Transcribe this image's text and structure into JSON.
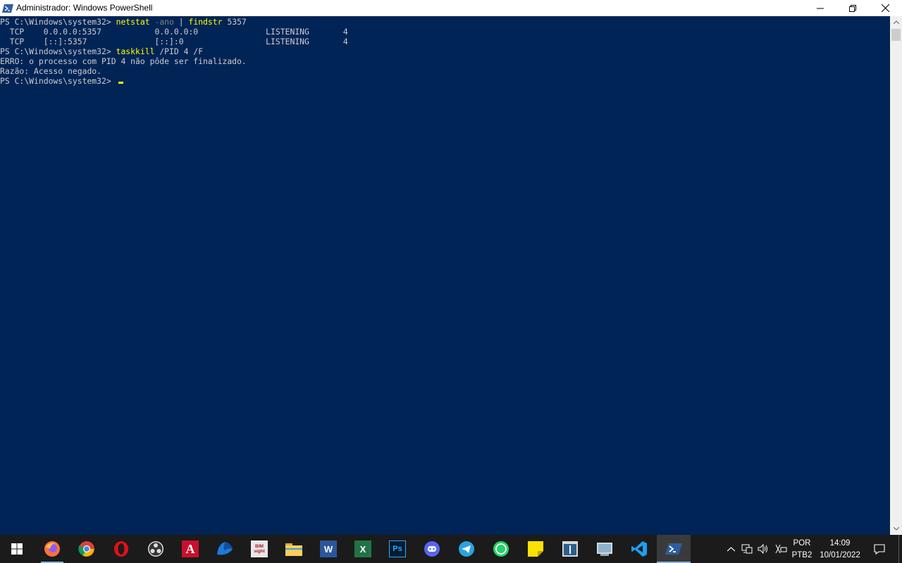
{
  "window": {
    "title": "Administrador: Windows PowerShell"
  },
  "console": {
    "lines": [
      {
        "segments": [
          {
            "text": "PS C:\\Windows\\system32> ",
            "style": "white"
          },
          {
            "text": "netstat",
            "style": "cmd"
          },
          {
            "text": " -ano",
            "style": "param"
          },
          {
            "text": " | ",
            "style": "white"
          },
          {
            "text": "findstr",
            "style": "cmd"
          },
          {
            "text": " 5357",
            "style": "white"
          }
        ]
      },
      {
        "segments": [
          {
            "text": "  TCP    0.0.0.0:5357           0.0.0.0:0              LISTENING       4",
            "style": "white"
          }
        ]
      },
      {
        "segments": [
          {
            "text": "  TCP    [::]:5357              [::]:0                 LISTENING       4",
            "style": "white"
          }
        ]
      },
      {
        "segments": [
          {
            "text": "PS C:\\Windows\\system32> ",
            "style": "white"
          },
          {
            "text": "taskkill",
            "style": "cmd"
          },
          {
            "text": " /PID 4 /F",
            "style": "white"
          }
        ]
      },
      {
        "segments": [
          {
            "text": "ERRO: o processo com PID 4 não pôde ser finalizado.",
            "style": "white"
          }
        ]
      },
      {
        "segments": [
          {
            "text": "Razão: Acesso negado.",
            "style": "white"
          }
        ]
      },
      {
        "segments": [
          {
            "text": "PS C:\\Windows\\system32> ",
            "style": "white"
          }
        ]
      }
    ],
    "colors": {
      "background": "#012456",
      "text": "#cccccc",
      "command": "#ffff00",
      "parameter": "#808080"
    }
  },
  "taskbar": {
    "apps": [
      {
        "name": "start",
        "icon": "windows-logo-icon"
      },
      {
        "name": "firefox",
        "icon": "firefox-icon"
      },
      {
        "name": "chrome",
        "icon": "chrome-icon"
      },
      {
        "name": "opera",
        "icon": "opera-icon"
      },
      {
        "name": "obs",
        "icon": "obs-icon"
      },
      {
        "name": "autocad",
        "icon": "autocad-icon",
        "label": "A"
      },
      {
        "name": "app-blue-shape",
        "icon": "blue-shape-icon"
      },
      {
        "name": "bim-sight",
        "icon": "bim-sight-icon",
        "label": "BIM sight"
      },
      {
        "name": "file-explorer",
        "icon": "folder-icon"
      },
      {
        "name": "word",
        "icon": "word-icon",
        "label": "W"
      },
      {
        "name": "excel",
        "icon": "excel-icon",
        "label": "X"
      },
      {
        "name": "photoshop",
        "icon": "photoshop-icon",
        "label": "Ps"
      },
      {
        "name": "discord",
        "icon": "discord-icon"
      },
      {
        "name": "telegram",
        "icon": "telegram-icon"
      },
      {
        "name": "whatsapp",
        "icon": "whatsapp-icon"
      },
      {
        "name": "sticky-notes",
        "icon": "sticky-notes-icon"
      },
      {
        "name": "app-window",
        "icon": "window-app-icon"
      },
      {
        "name": "system-tool",
        "icon": "system-tool-icon"
      },
      {
        "name": "vscode",
        "icon": "vscode-icon"
      },
      {
        "name": "powershell",
        "icon": "powershell-icon",
        "active": true
      }
    ],
    "tray": {
      "language_line1": "POR",
      "language_line2": "PTB2",
      "time": "14:09",
      "date": "10/01/2022"
    }
  }
}
